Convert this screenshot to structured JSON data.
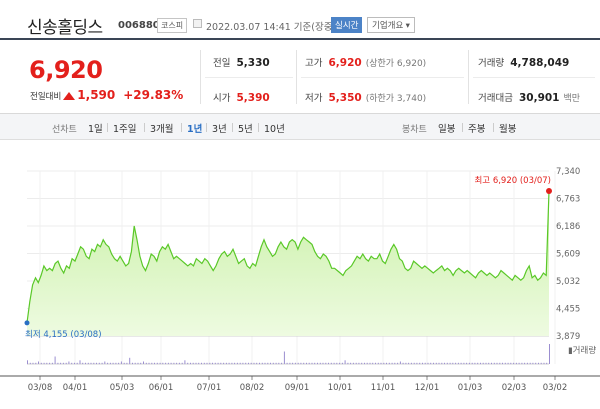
{
  "header": {
    "title": "신송홀딩스",
    "code": "006880",
    "market": "코스피",
    "datetime": "2022.03.07 14:41 기준(장중)",
    "realtime": "실시간",
    "company": "기업개요 ▾"
  },
  "quote": {
    "price": "6,920",
    "change_label": "전일대비",
    "change": "1,590",
    "change_pct": "+29.83%",
    "prev_label": "전일",
    "prev": "5,330",
    "high_label": "고가",
    "high": "6,920",
    "high_sub": "(상한가 6,920)",
    "volume_label": "거래량",
    "volume": "4,788,049",
    "open_label": "시가",
    "open": "5,390",
    "low_label": "저가",
    "low": "5,350",
    "low_sub": "(하한가 3,740)",
    "amount_label": "거래대금",
    "amount": "30,901",
    "amount_unit": "백만"
  },
  "periods": {
    "line_label": "선차트",
    "line_items": [
      "1일",
      "1주일",
      "3개월",
      "1년",
      "3년",
      "5년",
      "10년"
    ],
    "active": "1년",
    "candle_label": "봉차트",
    "candle_items": [
      "일봉",
      "주봉",
      "월봉"
    ]
  },
  "chart_data": {
    "type": "area",
    "y_ticks": [
      "7,340",
      "6,763",
      "6,186",
      "5,609",
      "5,032",
      "4,455",
      "3,879"
    ],
    "ylim": [
      3879,
      7340
    ],
    "x_ticks": [
      "03/08",
      "04/01",
      "05/03",
      "06/01",
      "07/01",
      "08/02",
      "09/01",
      "10/01",
      "11/01",
      "12/01",
      "01/03",
      "02/03",
      "03/02"
    ],
    "max_label": "최고 6,920 (03/07)",
    "min_label": "최저 4,155 (03/08)",
    "volume_label": "거래량",
    "price_values": [
      4155,
      4600,
      4950,
      5100,
      5000,
      5150,
      5350,
      5250,
      5300,
      5250,
      5400,
      5450,
      5300,
      5200,
      5350,
      5300,
      5500,
      5450,
      5600,
      5750,
      5700,
      5550,
      5500,
      5700,
      5650,
      5800,
      5750,
      5900,
      5800,
      5750,
      5600,
      5500,
      5450,
      5550,
      5450,
      5350,
      5400,
      5650,
      6186,
      5900,
      5550,
      5350,
      5250,
      5400,
      5600,
      5550,
      5450,
      5650,
      5750,
      5700,
      5800,
      5650,
      5500,
      5550,
      5500,
      5450,
      5400,
      5350,
      5400,
      5350,
      5500,
      5450,
      5400,
      5500,
      5450,
      5350,
      5250,
      5350,
      5500,
      5600,
      5650,
      5550,
      5600,
      5700,
      5550,
      5400,
      5450,
      5500,
      5350,
      5300,
      5400,
      5350,
      5550,
      5750,
      5900,
      5750,
      5650,
      5550,
      5600,
      5750,
      5850,
      5750,
      5700,
      5850,
      5900,
      5850,
      5700,
      5850,
      5950,
      5900,
      5850,
      5800,
      5650,
      5550,
      5500,
      5600,
      5550,
      5450,
      5300,
      5300,
      5250,
      5200,
      5150,
      5250,
      5300,
      5350,
      5450,
      5550,
      5500,
      5600,
      5500,
      5450,
      5550,
      5500,
      5500,
      5600,
      5450,
      5400,
      5550,
      5700,
      5800,
      5700,
      5500,
      5450,
      5300,
      5250,
      5300,
      5450,
      5400,
      5350,
      5300,
      5350,
      5300,
      5250,
      5200,
      5250,
      5300,
      5350,
      5250,
      5300,
      5250,
      5150,
      5250,
      5300,
      5250,
      5200,
      5250,
      5200,
      5150,
      5100,
      5200,
      5250,
      5200,
      5150,
      5200,
      5150,
      5100,
      5150,
      5250,
      5200,
      5150,
      5100,
      5050,
      5150,
      5100,
      5050,
      5100,
      5250,
      5350,
      5100,
      5150,
      5050,
      5100,
      5200,
      5150,
      6920
    ],
    "volume_values": [
      3,
      1,
      1,
      1,
      2,
      1,
      1,
      1,
      1,
      1,
      6,
      1,
      1,
      1,
      1,
      2,
      1,
      1,
      1,
      3,
      1,
      1,
      1,
      1,
      1,
      1,
      1,
      1,
      2,
      1,
      1,
      1,
      1,
      1,
      2,
      1,
      1,
      5,
      1,
      1,
      1,
      1,
      2,
      1,
      1,
      1,
      1,
      1,
      1,
      1,
      1,
      1,
      1,
      1,
      1,
      1,
      1,
      3,
      1,
      1,
      1,
      1,
      1,
      1,
      1,
      1,
      1,
      1,
      1,
      1,
      1,
      1,
      1,
      1,
      1,
      1,
      1,
      1,
      1,
      1,
      1,
      1,
      1,
      1,
      1,
      1,
      1,
      1,
      1,
      1,
      1,
      1,
      1,
      10,
      1,
      1,
      1,
      1,
      1,
      1,
      1,
      1,
      1,
      1,
      1,
      1,
      1,
      1,
      1,
      1,
      1,
      1,
      1,
      1,
      1,
      3,
      1,
      1,
      1,
      1,
      1,
      1,
      1,
      1,
      1,
      1,
      1,
      1,
      1,
      1,
      1,
      1,
      1,
      1,
      1,
      2,
      1,
      1,
      1,
      1,
      1,
      1,
      1,
      1,
      1,
      1,
      1,
      1,
      1,
      1,
      1,
      1,
      1,
      1,
      1,
      1,
      1,
      1,
      1,
      1,
      1,
      1,
      1,
      1,
      1,
      1,
      1,
      1,
      1,
      1,
      1,
      1,
      1,
      1,
      1,
      1,
      1,
      1,
      1,
      1,
      1,
      1,
      1,
      1,
      1,
      1,
      1,
      1,
      1,
      16
    ]
  },
  "colors": {
    "up": "#e3201c",
    "line": "#5ac828",
    "fill_top": "#c9f0a6",
    "fill_bottom": "#eefbe1",
    "low_dot": "#2a6fc4",
    "volume": "#9b8ed0"
  }
}
